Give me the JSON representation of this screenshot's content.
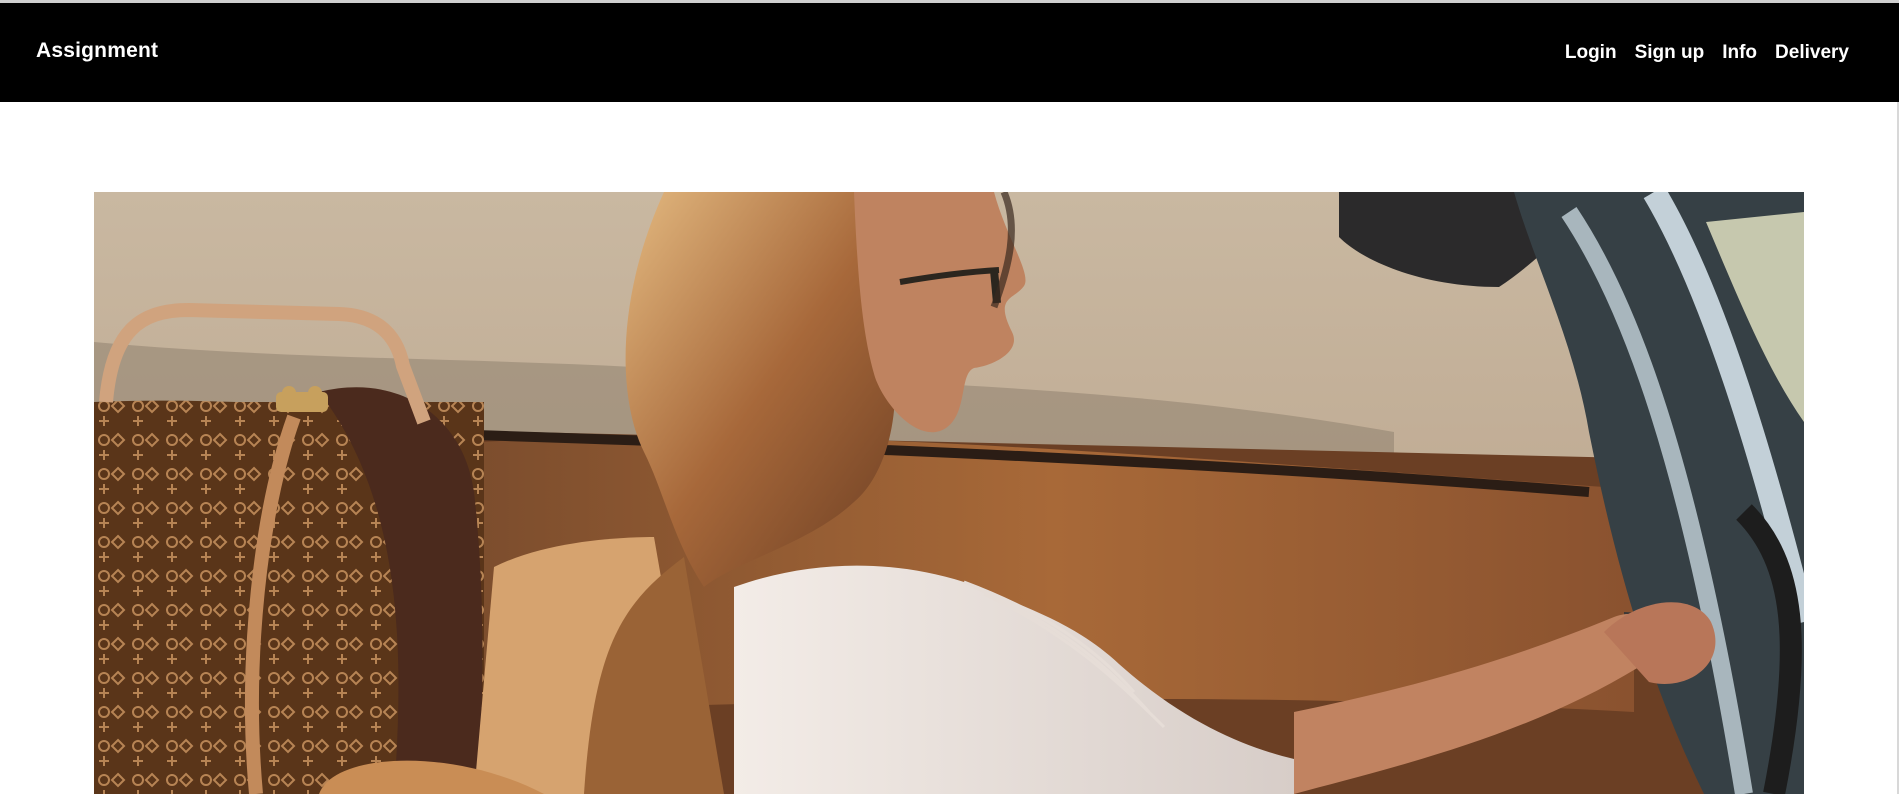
{
  "header": {
    "brand": "Assignment",
    "nav": [
      {
        "label": "Login"
      },
      {
        "label": "Sign up"
      },
      {
        "label": "Info"
      },
      {
        "label": "Delivery"
      }
    ]
  },
  "hero": {
    "image": "woman-driving-convertible-photo"
  },
  "colors": {
    "header_bg": "#000000",
    "header_text": "#ffffff",
    "page_bg": "#ffffff"
  }
}
